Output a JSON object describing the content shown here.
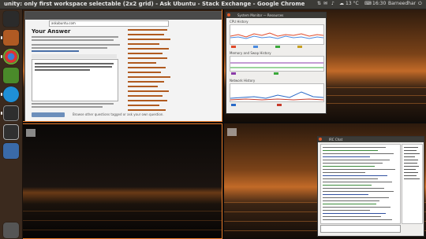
{
  "panel": {
    "window_title": "unity: only first workspace selectable (2x2 grid) - Ask Ubuntu - Stack Exchange - Google Chrome",
    "temperature": "13 °C",
    "clock": "16:30",
    "user": "Barneedhar"
  },
  "launcher": {
    "items": [
      {
        "name": "dash-home",
        "color": "#2b2b2b"
      },
      {
        "name": "files",
        "color": "#b05a23"
      },
      {
        "name": "chrome",
        "color": "#c9a227"
      },
      {
        "name": "ubuntu-software",
        "color": "#4a8a2a"
      },
      {
        "name": "skype",
        "color": "#1f8fd6"
      },
      {
        "name": "system-monitor",
        "color": "#2e2e2e"
      },
      {
        "name": "terminal",
        "color": "#303030"
      },
      {
        "name": "workspace-switcher",
        "color": "#3a6aa8"
      },
      {
        "name": "trash",
        "color": "#555555"
      }
    ]
  },
  "browser": {
    "url": "askubuntu.com",
    "answer_heading": "Your Answer",
    "post_button": "Post Your Answer",
    "bottom_note": "Browse other questions tagged    or ask your own question."
  },
  "sysmon": {
    "title": "System Monitor — Resources",
    "cpu_label": "CPU History",
    "mem_label": "Memory and Swap History",
    "net_label": "Network History"
  },
  "chat": {
    "title": "IRC Chat"
  },
  "colors": {
    "accent": "#e87b2a",
    "panel": "#3c3b37"
  }
}
